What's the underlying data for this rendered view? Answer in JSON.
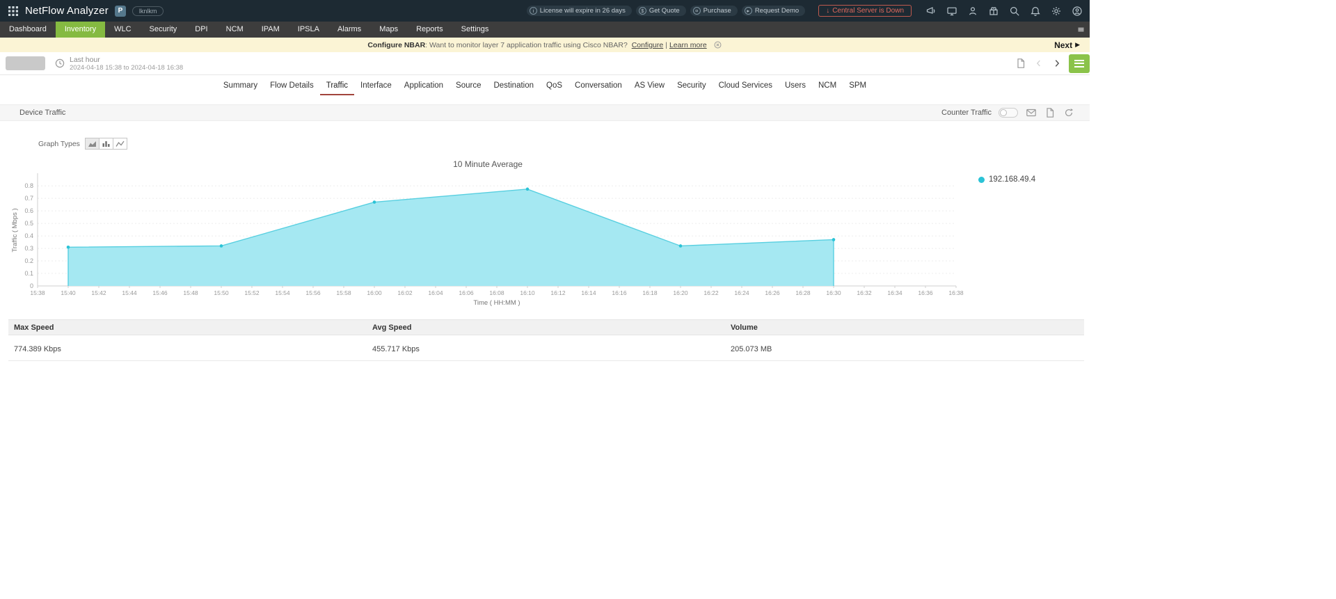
{
  "topbar": {
    "app_title": "NetFlow Analyzer",
    "product_badge": "P",
    "device_pill": "lknlkm",
    "status_items": [
      {
        "icon": "info-icon",
        "glyph": "i",
        "label": "License will expire in 26 days"
      },
      {
        "icon": "quote-icon",
        "glyph": "$",
        "label": "Get Quote"
      },
      {
        "icon": "purchase-icon",
        "glyph": "¤",
        "label": "Purchase"
      },
      {
        "icon": "demo-icon",
        "glyph": "▸",
        "label": "Request Demo"
      }
    ],
    "central_server": {
      "icon": "↓",
      "label": "Central Server is Down"
    }
  },
  "navbar": {
    "items": [
      "Dashboard",
      "Inventory",
      "WLC",
      "Security",
      "DPI",
      "NCM",
      "IPAM",
      "IPSLA",
      "Alarms",
      "Maps",
      "Reports",
      "Settings"
    ],
    "active": "Inventory"
  },
  "banner": {
    "title": "Configure NBAR",
    "text": ": Want to monitor layer 7 application traffic using Cisco NBAR? ",
    "configure_link": "Configure",
    "separator": "|",
    "learn_more_link": "Learn more",
    "next_label": "Next",
    "next_icon": "▶"
  },
  "subheader": {
    "time_label": "Last hour",
    "time_range": "2024-04-18 15:38 to 2024-04-18 16:38"
  },
  "tabs": {
    "items": [
      "Summary",
      "Flow Details",
      "Traffic",
      "Interface",
      "Application",
      "Source",
      "Destination",
      "QoS",
      "Conversation",
      "AS View",
      "Security",
      "Cloud Services",
      "Users",
      "NCM",
      "SPM"
    ],
    "active": "Traffic"
  },
  "device_traffic": {
    "title": "Device Traffic",
    "counter_traffic_label": "Counter Traffic",
    "counter_traffic_on": false
  },
  "graph_types": {
    "label": "Graph Types",
    "options": [
      "area",
      "bar",
      "line"
    ],
    "selected": "area"
  },
  "chart_data": {
    "type": "area",
    "title": "10 Minute Average",
    "xlabel": "Time ( HH:MM )",
    "ylabel": "Traffic ( Mbps )",
    "x_ticks": [
      "15:38",
      "15:40",
      "15:42",
      "15:44",
      "15:46",
      "15:48",
      "15:50",
      "15:52",
      "15:54",
      "15:56",
      "15:58",
      "16:00",
      "16:02",
      "16:04",
      "16:06",
      "16:08",
      "16:10",
      "16:12",
      "16:14",
      "16:16",
      "16:18",
      "16:20",
      "16:22",
      "16:24",
      "16:26",
      "16:28",
      "16:30",
      "16:32",
      "16:34",
      "16:36",
      "16:38"
    ],
    "y_ticks": [
      0,
      0.1,
      0.2,
      0.3,
      0.4,
      0.5,
      0.6,
      0.7,
      0.8
    ],
    "ylim": [
      0,
      0.89
    ],
    "grid": "horizontal-dashed",
    "legend_position": "right",
    "series": [
      {
        "name": "192.168.49.4",
        "color": "#2bc3d6",
        "line_color": "#57cfe0",
        "fill_color": "#a5e8f2",
        "points": [
          {
            "x": "15:40",
            "y": 0.31
          },
          {
            "x": "15:50",
            "y": 0.32
          },
          {
            "x": "16:00",
            "y": 0.67
          },
          {
            "x": "16:10",
            "y": 0.774
          },
          {
            "x": "16:20",
            "y": 0.32
          },
          {
            "x": "16:30",
            "y": 0.37
          }
        ]
      }
    ]
  },
  "summary_table": {
    "headers": [
      "Max Speed",
      "Avg Speed",
      "Volume"
    ],
    "rows": [
      [
        "774.389 Kbps",
        "455.717 Kbps",
        "205.073 MB"
      ]
    ]
  }
}
